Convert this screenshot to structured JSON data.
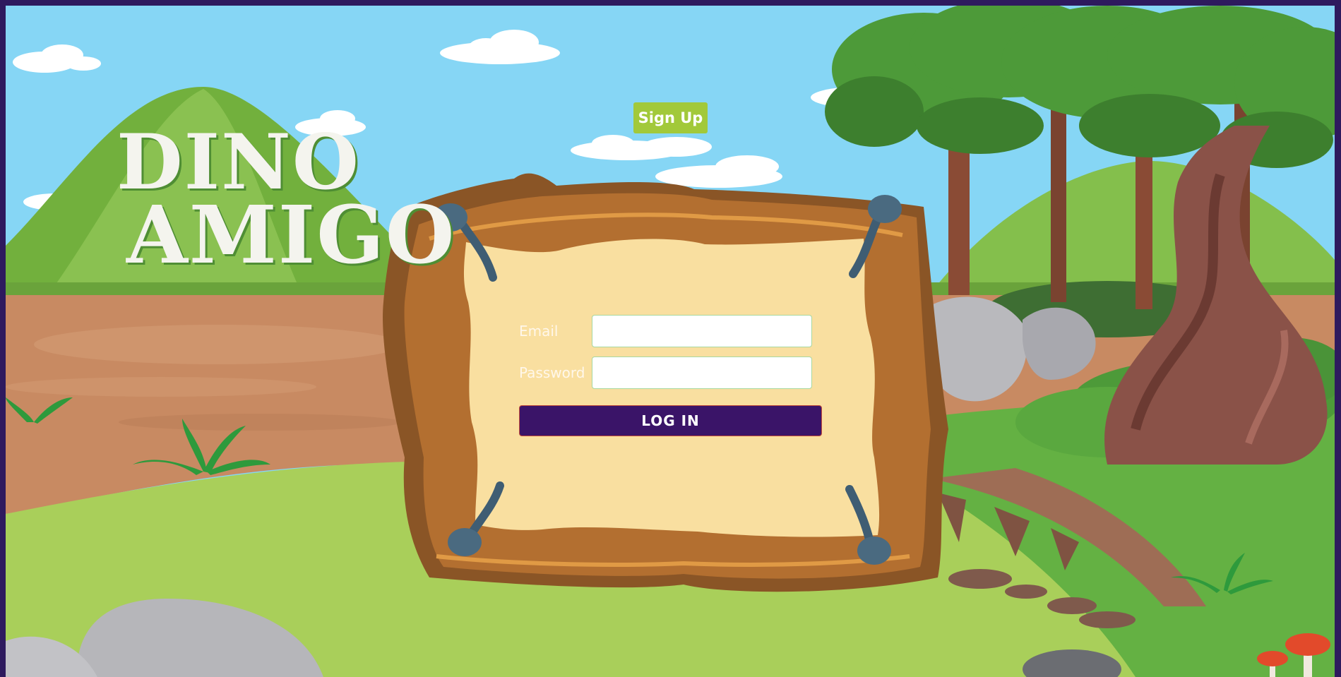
{
  "logo": {
    "line1": "DINO",
    "line2": "AMIGO"
  },
  "header": {
    "signup_label": "Sign Up"
  },
  "login_form": {
    "email_label": "Email",
    "email_value": "",
    "password_label": "Password",
    "password_value": "",
    "login_label": "LOG IN"
  },
  "colors": {
    "frame": "#2e1a5e",
    "sky": "#86d6f5",
    "signup_button": "#a2c93a",
    "login_button": "#3a1468",
    "parchment": "#f9dfa0",
    "wood": "#8a5526"
  }
}
